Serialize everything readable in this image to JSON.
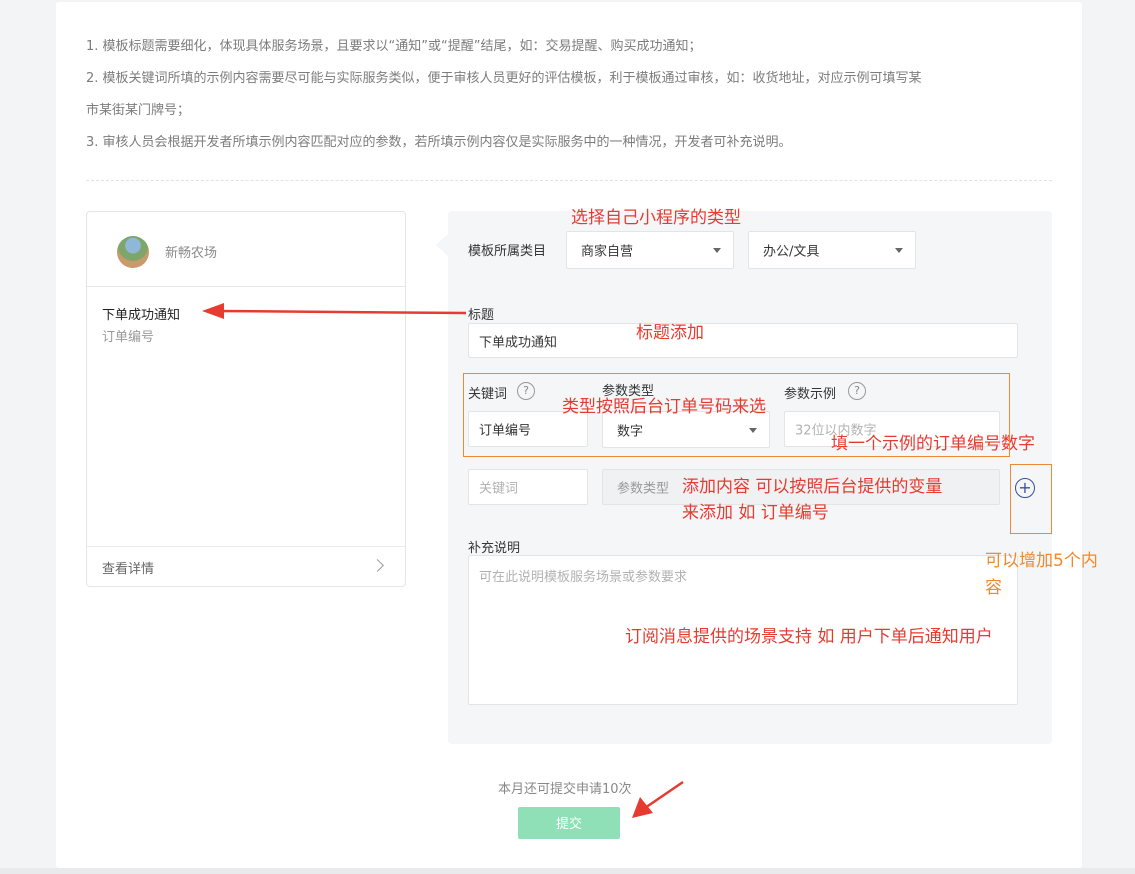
{
  "tips": [
    "1. 模板标题需要细化，体现具体服务场景，且要求以“通知”或“提醒”结尾，如：交易提醒、购买成功通知；",
    "2. 模板关键词所填的示例内容需要尽可能与实际服务类似，便于审核人员更好的评估模板，利于模板通过审核，如：收货地址，对应示例可填写某",
    "市某街某门牌号；",
    "3. 审核人员会根据开发者所填示例内容匹配对应的参数，若所填示例内容仅是实际服务中的一种情况，开发者可补充说明。"
  ],
  "preview": {
    "shop_name": "新畅农场",
    "title": "下单成功通知",
    "keyword": "订单编号",
    "detail_label": "查看详情"
  },
  "form": {
    "category_label": "模板所属类目",
    "category_primary": "商家自营",
    "category_secondary": "办公/文具",
    "title_label": "标题",
    "title_value": "下单成功通知",
    "keyword_header": "关键词",
    "param_type_header": "参数类型",
    "param_example_header": "参数示例",
    "row1_keyword": "订单编号",
    "row1_type": "数字",
    "row1_example_placeholder": "32位以内数字",
    "row2_keyword_placeholder": "关键词",
    "row2_type_placeholder": "参数类型",
    "supplement_label": "补充说明",
    "supplement_placeholder": "可在此说明模板服务场景或参数要求",
    "help_glyph": "?",
    "add_glyph": "+"
  },
  "footer": {
    "quota_text": "本月还可提交申请10次",
    "submit_label": "提交"
  },
  "annotations": {
    "select_type": "选择自己小程序的类型",
    "title_add": "标题添加",
    "type_by_backend": "类型按照后台订单号码来选",
    "fill_example": "填一个示例的订单编号数字",
    "add_content_line1": "添加内容 可以按照后台提供的变量",
    "add_content_line2": "来添加 如 订单编号",
    "add_five_line1": "可以增加5个内",
    "add_five_line2": "容",
    "scene_support": "订阅消息提供的场景支持 如 用户下单后通知用户"
  },
  "colors": {
    "accent_green": "#8fe0b6",
    "annotation_red": "#e63b30",
    "annotation_orange": "#f1892d",
    "add_icon_blue": "#3c4fa0"
  }
}
